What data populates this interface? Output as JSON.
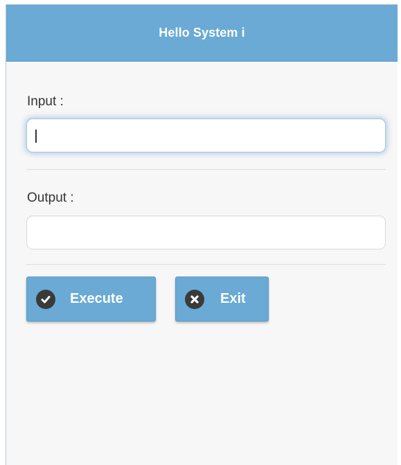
{
  "window": {
    "title": "Hello System i"
  },
  "form": {
    "input_label": "Input :",
    "input_value": "",
    "output_label": "Output :",
    "output_value": ""
  },
  "buttons": {
    "execute": {
      "label": "Execute",
      "icon": "checkmark-icon"
    },
    "exit": {
      "label": "Exit",
      "icon": "close-icon"
    }
  },
  "colors": {
    "header_bg": "#6aaad5",
    "button_bg": "#6aaad5",
    "icon_bg": "#3a3a3a"
  }
}
